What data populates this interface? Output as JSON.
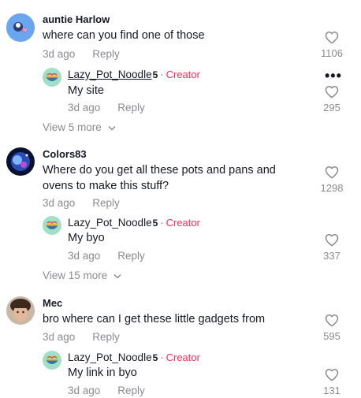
{
  "threads": [
    {
      "username": "auntie Harlow",
      "text": [
        "where can you find one of those"
      ],
      "time": "3d ago",
      "reply_label": "Reply",
      "likes": "1106",
      "replies_toggle": "View 5 more",
      "reply": {
        "username": "Lazy_Pot_Noodle",
        "badge": "5",
        "creator_label": "Creator",
        "text": "My site",
        "time": "3d ago",
        "reply_label": "Reply",
        "likes": "295"
      }
    },
    {
      "username": "Colors83",
      "text": [
        "Where do you get all these pots and pans and",
        "ovens to make this stuff?"
      ],
      "time": "3d ago",
      "reply_label": "Reply",
      "likes": "1298",
      "replies_toggle": "View 15 more",
      "reply": {
        "username": "Lazy_Pot_Noodle",
        "badge": "5",
        "creator_label": "Creator",
        "text": "My byo",
        "time": "3d ago",
        "reply_label": "Reply",
        "likes": "337"
      }
    },
    {
      "username": "Mec",
      "text": [
        "bro where can I get these little gadgets from"
      ],
      "time": "3d ago",
      "reply_label": "Reply",
      "likes": "595",
      "reply": {
        "username": "Lazy_Pot_Noodle",
        "badge": "5",
        "creator_label": "Creator",
        "text": "My link in byo",
        "time": "3d ago",
        "reply_label": "Reply",
        "likes": "131"
      }
    }
  ],
  "colors": {
    "creator": "#fe2c55",
    "secondary_text": "#8a8b91",
    "primary_text": "#161823"
  },
  "icons": {
    "like": "heart-outline-icon",
    "more": "more-horizontal-icon",
    "expand": "chevron-down-icon"
  }
}
